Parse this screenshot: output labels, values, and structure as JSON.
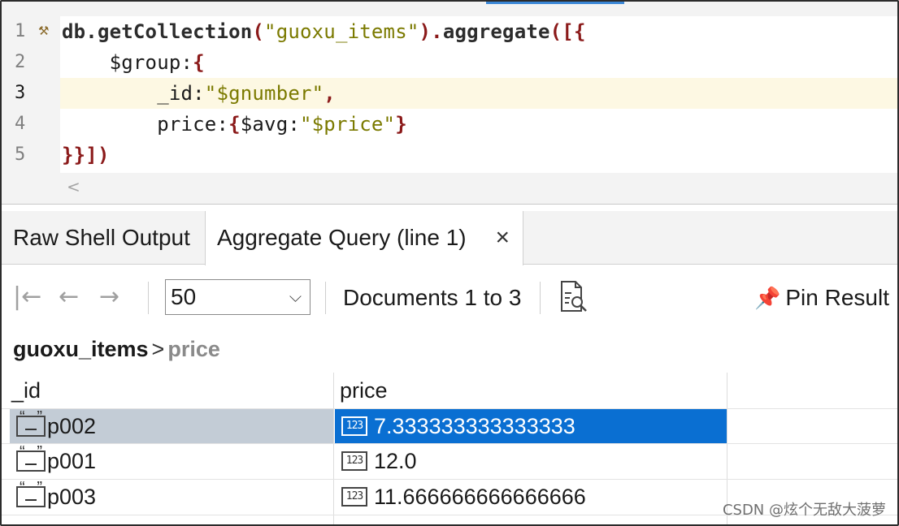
{
  "editor": {
    "lines": [
      {
        "num": "1",
        "current": false
      },
      {
        "num": "2",
        "current": false
      },
      {
        "num": "3",
        "current": true
      },
      {
        "num": "4",
        "current": false
      },
      {
        "num": "5",
        "current": false
      }
    ],
    "code": {
      "l1_db": "db.getCollection",
      "l1_paren_open": "(",
      "l1_str": "\"guoxu_items\"",
      "l1_paren_close": ").",
      "l1_fn": "aggregate",
      "l1_tail": "([{",
      "l2_key": "    $group:",
      "l2_brace": "{",
      "l3_key": "        _id:",
      "l3_str": "\"$gnumber\"",
      "l3_comma": ",",
      "l4_key": "        price:",
      "l4_brace_open": "{",
      "l4_inner": "$avg:",
      "l4_str": "\"$price\"",
      "l4_brace_close": "}",
      "l5_close": "}}])"
    },
    "scroll_left_glyph": "<"
  },
  "tabs": {
    "raw_label": "Raw Shell Output",
    "agg_label": "Aggregate Query (line 1)",
    "close_glyph": "×"
  },
  "toolbar": {
    "first_glyph": "|←",
    "prev_glyph": "←",
    "next_glyph": "→",
    "page_size": "50",
    "documents_label": "Documents 1 to 3",
    "pin_label": "Pin Result"
  },
  "breadcrumb": {
    "collection": "guoxu_items",
    "separator": ">",
    "field": "price"
  },
  "grid": {
    "columns": [
      "_id",
      "price"
    ],
    "rows": [
      {
        "id": "p002",
        "price": "7.333333333333333",
        "selected": true
      },
      {
        "id": "p001",
        "price": "12.0",
        "selected": false
      },
      {
        "id": "p003",
        "price": "11.666666666666666",
        "selected": false
      }
    ],
    "number_icon_text": "123"
  },
  "watermark": "CSDN @炫个无敌大菠萝",
  "colors": {
    "selection": "#0a6fd2",
    "row_selection": "#c3ccd6",
    "string": "#7b7a00",
    "bracket": "#8b1a1a",
    "current_line": "#fdf8e3"
  }
}
